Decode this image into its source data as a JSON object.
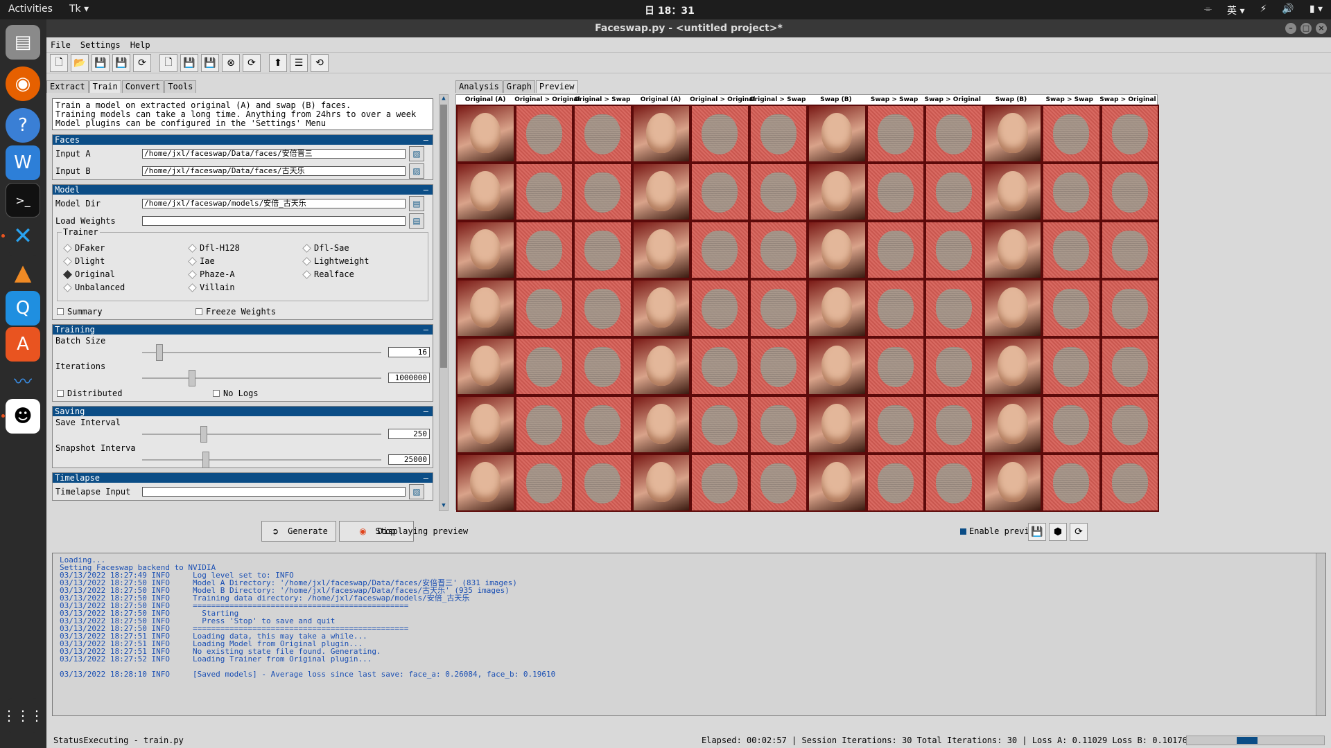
{
  "system": {
    "activities": "Activities",
    "app_menu": "Tk ▾",
    "clock": "日 18：31",
    "tray": [
      "⌯",
      "英 ▾",
      "⚡",
      "🔊",
      "▮ ▾"
    ]
  },
  "window": {
    "title": "Faceswap.py - <untitled project>*"
  },
  "menu": {
    "items": [
      "File",
      "Settings",
      "Help"
    ]
  },
  "left_tabs": [
    "Extract",
    "Train",
    "Convert",
    "Tools"
  ],
  "right_tabs": [
    "Analysis",
    "Graph",
    "Preview"
  ],
  "description": "Train a model on extracted original (A) and swap (B) faces.\nTraining models can take a long time. Anything from 24hrs to over a week\nModel plugins can be configured in the 'Settings' Menu",
  "faces": {
    "header": "Faces",
    "input_a_label": "Input A",
    "input_a_value": "/home/jxl/faceswap/Data/faces/安倍晋三",
    "input_b_label": "Input B",
    "input_b_value": "/home/jxl/faceswap/Data/faces/古天乐"
  },
  "model": {
    "header": "Model",
    "model_dir_label": "Model Dir",
    "model_dir_value": "/home/jxl/faceswap/models/安倍_古天乐",
    "load_weights_label": "Load Weights",
    "load_weights_value": "",
    "trainer_legend": "Trainer",
    "trainers": [
      {
        "label": "DFaker",
        "selected": false
      },
      {
        "label": "Dfl-H128",
        "selected": false
      },
      {
        "label": "Dfl-Sae",
        "selected": false
      },
      {
        "label": "Dlight",
        "selected": false
      },
      {
        "label": "Iae",
        "selected": false
      },
      {
        "label": "Lightweight",
        "selected": false
      },
      {
        "label": "Original",
        "selected": true
      },
      {
        "label": "Phaze-A",
        "selected": false
      },
      {
        "label": "Realface",
        "selected": false
      },
      {
        "label": "Unbalanced",
        "selected": false
      },
      {
        "label": "Villain",
        "selected": false
      }
    ],
    "summary_label": "Summary",
    "freeze_weights_label": "Freeze Weights"
  },
  "training": {
    "header": "Training",
    "batch_size_label": "Batch Size",
    "batch_size_value": "16",
    "batch_size_level": 0.06,
    "iterations_label": "Iterations",
    "iterations_value": "1000000",
    "iterations_level": 0.2,
    "distributed_label": "Distributed",
    "no_logs_label": "No Logs"
  },
  "saving": {
    "header": "Saving",
    "save_interval_label": "Save Interval",
    "save_interval_value": "250",
    "save_interval_level": 0.25,
    "snapshot_label": "Snapshot Interva",
    "snapshot_value": "25000",
    "snapshot_level": 0.26
  },
  "timelapse": {
    "header": "Timelapse",
    "input_label": "Timelapse Input"
  },
  "preview": {
    "columns": [
      "Original (A)",
      "Original > Original",
      "Original > Swap",
      "Original (A)",
      "Original > Original",
      "Original > Swap",
      "Swap (B)",
      "Swap > Swap",
      "Swap > Original",
      "Swap (B)",
      "Swap > Swap",
      "Swap > Original"
    ],
    "rows": 7,
    "status": "Displaying preview",
    "enable_label": "Enable preview"
  },
  "actions": {
    "generate": "Generate",
    "stop": "Stop"
  },
  "console": {
    "lines": [
      "Loading...",
      "Setting Faceswap backend to NVIDIA",
      "03/13/2022 18:27:49 INFO     Log level set to: INFO",
      "03/13/2022 18:27:50 INFO     Model A Directory: '/home/jxl/faceswap/Data/faces/安倍晋三' (831 images)",
      "03/13/2022 18:27:50 INFO     Model B Directory: '/home/jxl/faceswap/Data/faces/古天乐' (935 images)",
      "03/13/2022 18:27:50 INFO     Training data directory: /home/jxl/faceswap/models/安倍_古天乐",
      "03/13/2022 18:27:50 INFO     ===============================================",
      "03/13/2022 18:27:50 INFO       Starting",
      "03/13/2022 18:27:50 INFO       Press 'Stop' to save and quit",
      "03/13/2022 18:27:50 INFO     ===============================================",
      "03/13/2022 18:27:51 INFO     Loading data, this may take a while...",
      "03/13/2022 18:27:51 INFO     Loading Model from Original plugin...",
      "03/13/2022 18:27:51 INFO     No existing state file found. Generating.",
      "03/13/2022 18:27:52 INFO     Loading Trainer from Original plugin...",
      "",
      "03/13/2022 18:28:10 INFO     [Saved models] - Average loss since last save: face_a: 0.26084, face_b: 0.19610"
    ]
  },
  "status": {
    "left": "StatusExecuting - train.py",
    "right": "Elapsed: 00:02:57 | Session Iterations: 30  Total Iterations: 30 | Loss A: 0.11029  Loss B: 0.10176"
  }
}
